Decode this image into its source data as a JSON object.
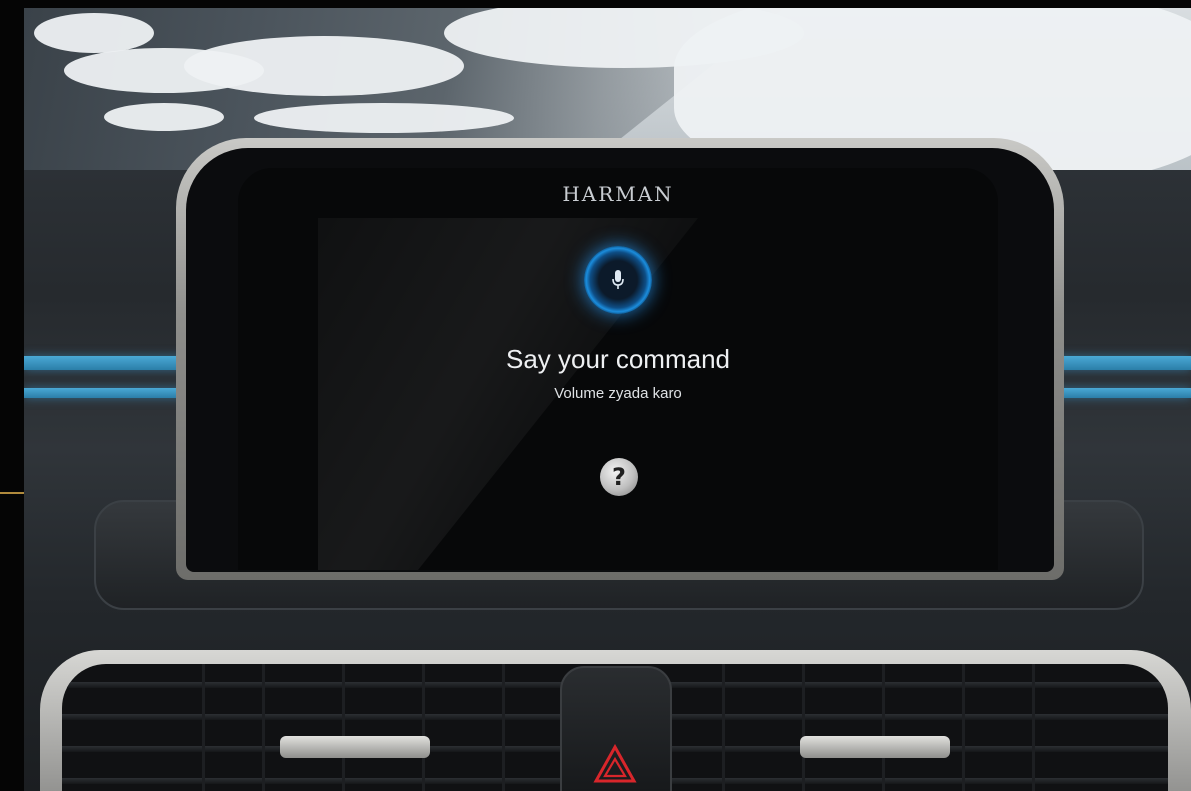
{
  "screen": {
    "brand": "HARMAN",
    "voice": {
      "title": "Say your command",
      "hint": "Volume zyada karo"
    },
    "help_label": "?"
  },
  "icons": {
    "mic": "microphone-icon",
    "help": "question-mark-icon",
    "hazard": "hazard-triangle-icon"
  },
  "colors": {
    "accent_blue": "#1b8ddd",
    "hazard_red": "#d8262b",
    "screen_bg": "#070809"
  }
}
